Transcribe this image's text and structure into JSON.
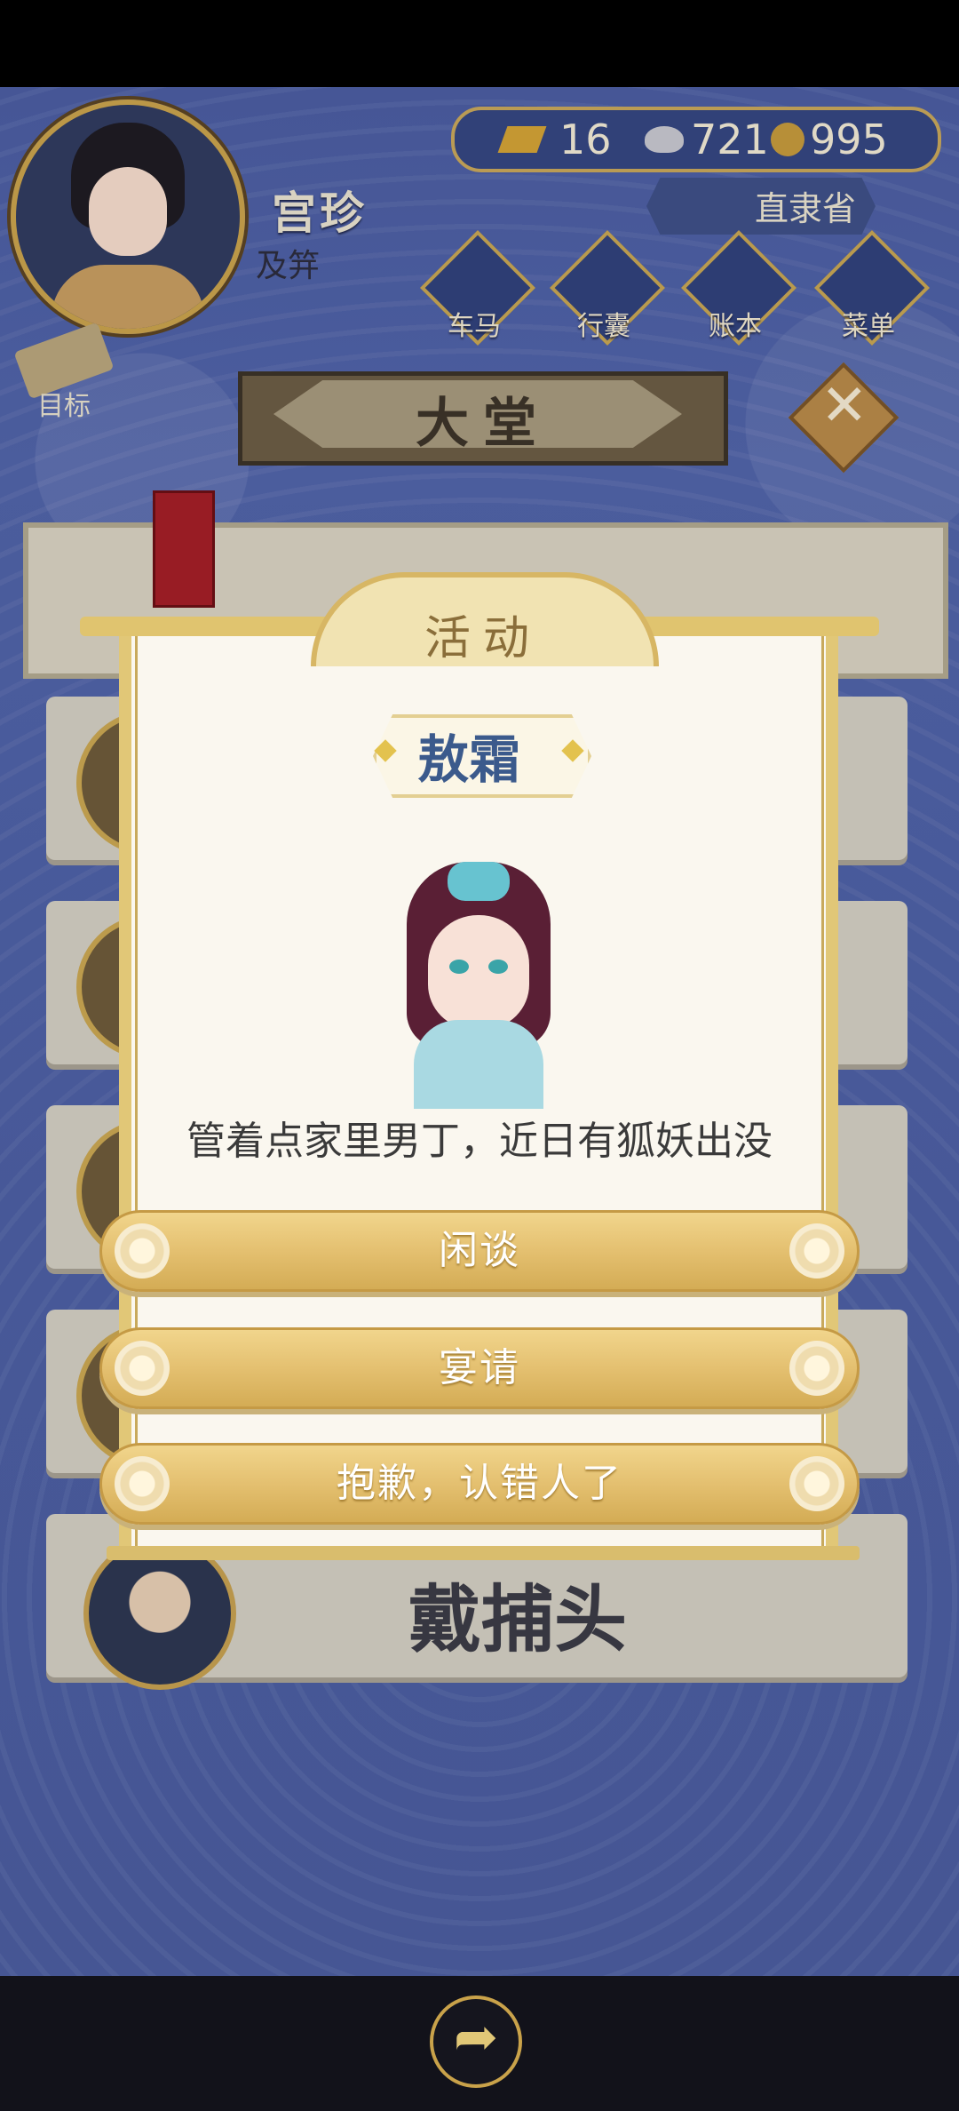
{
  "player": {
    "name": "宫珍",
    "rank": "及笄"
  },
  "currency": {
    "gold": "16",
    "silver": "721",
    "coins": "995"
  },
  "location": {
    "province": "直隶省"
  },
  "nav": [
    {
      "label": "车马",
      "icon": "carriage-icon"
    },
    {
      "label": "行囊",
      "icon": "bag-icon"
    },
    {
      "label": "账本",
      "icon": "ledger-icon"
    },
    {
      "label": "菜单",
      "icon": "menu-dots-icon"
    }
  ],
  "goal_label": "目标",
  "hall_title": "大堂",
  "background_card": {
    "name": "戴捕头"
  },
  "dialog": {
    "header": "活动",
    "subtitle": "敖霜",
    "message": "管着点家里男丁，近日有狐妖出没",
    "options": [
      "闲谈",
      "宴请",
      "抱歉，认错人了"
    ]
  },
  "colors": {
    "accent_gold": "#e1c777",
    "scene_blue": "#4a5ca0",
    "subtitle_blue": "#3b5a8c"
  }
}
